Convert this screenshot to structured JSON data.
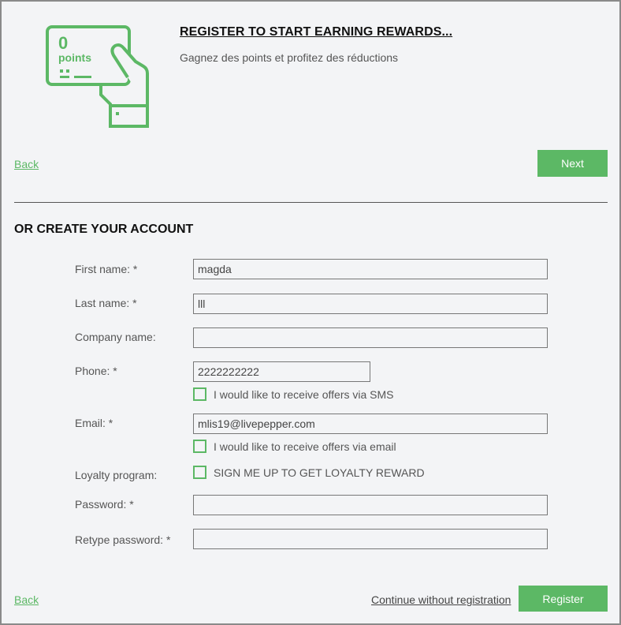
{
  "promo": {
    "card_points_value": "0",
    "card_points_label": "points",
    "title": "REGISTER TO START EARNING REWARDS...",
    "subtitle": "Gagnez des points et profitez des réductions"
  },
  "nav": {
    "back_label": "Back",
    "next_label": "Next"
  },
  "form": {
    "section_title": "OR CREATE YOUR ACCOUNT",
    "first_name": {
      "label": "First name: *",
      "value": "magda"
    },
    "last_name": {
      "label": "Last name: *",
      "value": "lll"
    },
    "company_name": {
      "label": "Company name:",
      "value": ""
    },
    "phone": {
      "label": "Phone: *",
      "value": "2222222222",
      "sms_opt_in_label": "I would like to receive offers via SMS",
      "sms_opt_in_checked": false
    },
    "email": {
      "label": "Email: *",
      "value": "mlis19@livepepper.com",
      "email_opt_in_label": "I would like to receive offers via email",
      "email_opt_in_checked": false
    },
    "loyalty": {
      "label": "Loyalty program:",
      "checkbox_label": "SIGN ME UP TO GET LOYALTY REWARD",
      "checked": false
    },
    "password": {
      "label": "Password: *",
      "value": ""
    },
    "retype_password": {
      "label": "Retype password: *",
      "value": ""
    }
  },
  "footer": {
    "back_label": "Back",
    "continue_label": "Continue without registration",
    "register_label": "Register"
  },
  "colors": {
    "accent": "#5cb865",
    "background": "#f3f4f6"
  },
  "icons": {
    "hero": "loyalty-card-in-hand-icon"
  }
}
